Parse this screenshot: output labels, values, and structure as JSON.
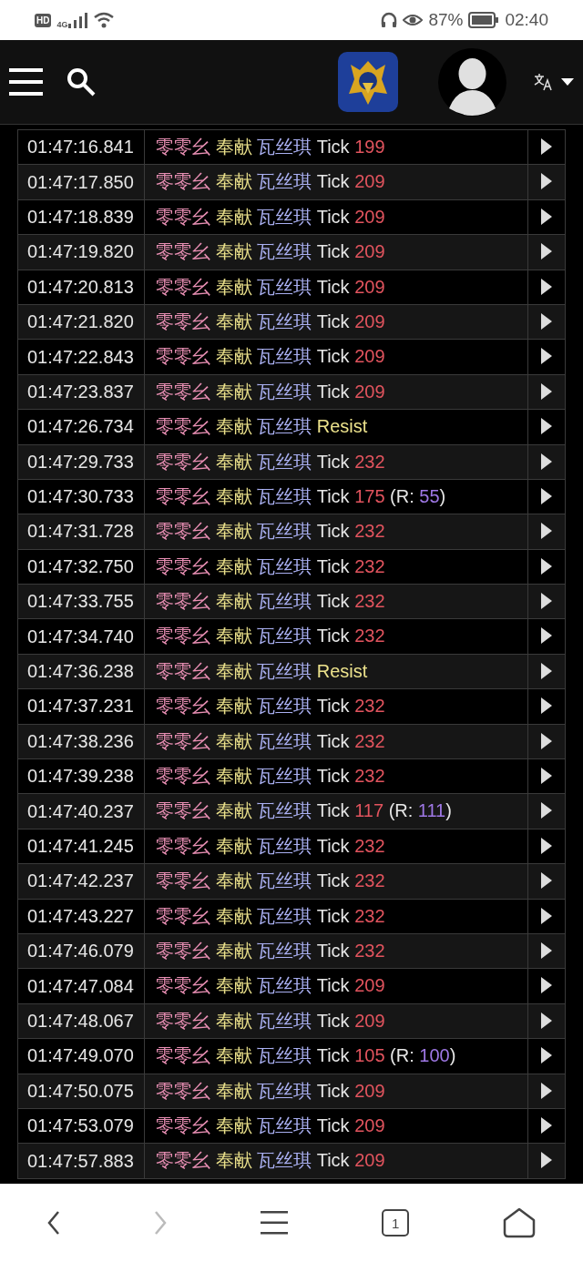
{
  "status_bar": {
    "hd": "HD",
    "network": "4G",
    "battery": "87%",
    "time": "02:40"
  },
  "log": {
    "rows": [
      {
        "time": "01:47:16.841",
        "source": "零零幺",
        "spell": "奉献",
        "target": "瓦丝琪",
        "kind": "tick",
        "event": "Tick",
        "amount": "199"
      },
      {
        "time": "01:47:17.850",
        "source": "零零幺",
        "spell": "奉献",
        "target": "瓦丝琪",
        "kind": "tick",
        "event": "Tick",
        "amount": "209"
      },
      {
        "time": "01:47:18.839",
        "source": "零零幺",
        "spell": "奉献",
        "target": "瓦丝琪",
        "kind": "tick",
        "event": "Tick",
        "amount": "209"
      },
      {
        "time": "01:47:19.820",
        "source": "零零幺",
        "spell": "奉献",
        "target": "瓦丝琪",
        "kind": "tick",
        "event": "Tick",
        "amount": "209"
      },
      {
        "time": "01:47:20.813",
        "source": "零零幺",
        "spell": "奉献",
        "target": "瓦丝琪",
        "kind": "tick",
        "event": "Tick",
        "amount": "209"
      },
      {
        "time": "01:47:21.820",
        "source": "零零幺",
        "spell": "奉献",
        "target": "瓦丝琪",
        "kind": "tick",
        "event": "Tick",
        "amount": "209"
      },
      {
        "time": "01:47:22.843",
        "source": "零零幺",
        "spell": "奉献",
        "target": "瓦丝琪",
        "kind": "tick",
        "event": "Tick",
        "amount": "209"
      },
      {
        "time": "01:47:23.837",
        "source": "零零幺",
        "spell": "奉献",
        "target": "瓦丝琪",
        "kind": "tick",
        "event": "Tick",
        "amount": "209"
      },
      {
        "time": "01:47:26.734",
        "source": "零零幺",
        "spell": "奉献",
        "target": "瓦丝琪",
        "kind": "resist",
        "event": "Resist"
      },
      {
        "time": "01:47:29.733",
        "source": "零零幺",
        "spell": "奉献",
        "target": "瓦丝琪",
        "kind": "tick",
        "event": "Tick",
        "amount": "232"
      },
      {
        "time": "01:47:30.733",
        "source": "零零幺",
        "spell": "奉献",
        "target": "瓦丝琪",
        "kind": "tick",
        "event": "Tick",
        "amount": "175",
        "resist_open": "(R:",
        "resisted": "55",
        "resist_close": ")"
      },
      {
        "time": "01:47:31.728",
        "source": "零零幺",
        "spell": "奉献",
        "target": "瓦丝琪",
        "kind": "tick",
        "event": "Tick",
        "amount": "232"
      },
      {
        "time": "01:47:32.750",
        "source": "零零幺",
        "spell": "奉献",
        "target": "瓦丝琪",
        "kind": "tick",
        "event": "Tick",
        "amount": "232"
      },
      {
        "time": "01:47:33.755",
        "source": "零零幺",
        "spell": "奉献",
        "target": "瓦丝琪",
        "kind": "tick",
        "event": "Tick",
        "amount": "232"
      },
      {
        "time": "01:47:34.740",
        "source": "零零幺",
        "spell": "奉献",
        "target": "瓦丝琪",
        "kind": "tick",
        "event": "Tick",
        "amount": "232"
      },
      {
        "time": "01:47:36.238",
        "source": "零零幺",
        "spell": "奉献",
        "target": "瓦丝琪",
        "kind": "resist",
        "event": "Resist"
      },
      {
        "time": "01:47:37.231",
        "source": "零零幺",
        "spell": "奉献",
        "target": "瓦丝琪",
        "kind": "tick",
        "event": "Tick",
        "amount": "232"
      },
      {
        "time": "01:47:38.236",
        "source": "零零幺",
        "spell": "奉献",
        "target": "瓦丝琪",
        "kind": "tick",
        "event": "Tick",
        "amount": "232"
      },
      {
        "time": "01:47:39.238",
        "source": "零零幺",
        "spell": "奉献",
        "target": "瓦丝琪",
        "kind": "tick",
        "event": "Tick",
        "amount": "232"
      },
      {
        "time": "01:47:40.237",
        "source": "零零幺",
        "spell": "奉献",
        "target": "瓦丝琪",
        "kind": "tick",
        "event": "Tick",
        "amount": "117",
        "resist_open": "(R:",
        "resisted": "111",
        "resist_close": ")"
      },
      {
        "time": "01:47:41.245",
        "source": "零零幺",
        "spell": "奉献",
        "target": "瓦丝琪",
        "kind": "tick",
        "event": "Tick",
        "amount": "232"
      },
      {
        "time": "01:47:42.237",
        "source": "零零幺",
        "spell": "奉献",
        "target": "瓦丝琪",
        "kind": "tick",
        "event": "Tick",
        "amount": "232"
      },
      {
        "time": "01:47:43.227",
        "source": "零零幺",
        "spell": "奉献",
        "target": "瓦丝琪",
        "kind": "tick",
        "event": "Tick",
        "amount": "232"
      },
      {
        "time": "01:47:46.079",
        "source": "零零幺",
        "spell": "奉献",
        "target": "瓦丝琪",
        "kind": "tick",
        "event": "Tick",
        "amount": "232"
      },
      {
        "time": "01:47:47.084",
        "source": "零零幺",
        "spell": "奉献",
        "target": "瓦丝琪",
        "kind": "tick",
        "event": "Tick",
        "amount": "209"
      },
      {
        "time": "01:47:48.067",
        "source": "零零幺",
        "spell": "奉献",
        "target": "瓦丝琪",
        "kind": "tick",
        "event": "Tick",
        "amount": "209"
      },
      {
        "time": "01:47:49.070",
        "source": "零零幺",
        "spell": "奉献",
        "target": "瓦丝琪",
        "kind": "tick",
        "event": "Tick",
        "amount": "105",
        "resist_open": "(R:",
        "resisted": "100",
        "resist_close": ")"
      },
      {
        "time": "01:47:50.075",
        "source": "零零幺",
        "spell": "奉献",
        "target": "瓦丝琪",
        "kind": "tick",
        "event": "Tick",
        "amount": "209"
      },
      {
        "time": "01:47:53.079",
        "source": "零零幺",
        "spell": "奉献",
        "target": "瓦丝琪",
        "kind": "tick",
        "event": "Tick",
        "amount": "209"
      },
      {
        "time": "01:47:57.883",
        "source": "零零幺",
        "spell": "奉献",
        "target": "瓦丝琪",
        "kind": "tick",
        "event": "Tick",
        "amount": "209"
      }
    ]
  },
  "browser_bar": {
    "tab_count": "1"
  }
}
